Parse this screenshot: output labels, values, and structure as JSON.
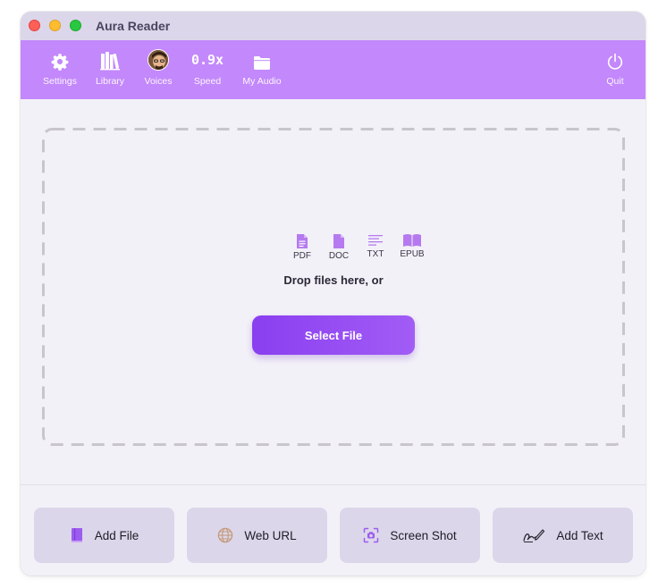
{
  "window": {
    "title": "Aura Reader"
  },
  "toolbar": {
    "settings": {
      "label": "Settings",
      "icon": "gear-icon"
    },
    "library": {
      "label": "Library",
      "icon": "books-icon"
    },
    "voices": {
      "label": "Voices",
      "icon": "avatar"
    },
    "speed": {
      "label": "Speed",
      "value": "0.9x"
    },
    "my_audio": {
      "label": "My Audio",
      "icon": "folder-icon"
    },
    "quit": {
      "label": "Quit",
      "icon": "power-icon"
    }
  },
  "dropzone": {
    "formats": [
      {
        "label": "PDF",
        "icon": "document-icon"
      },
      {
        "label": "DOC",
        "icon": "document-icon"
      },
      {
        "label": "TXT",
        "icon": "text-lines-icon"
      },
      {
        "label": "EPUB",
        "icon": "open-book-icon"
      }
    ],
    "prompt": "Drop files here, or",
    "select_label": "Select File"
  },
  "actions": [
    {
      "label": "Add File",
      "icon": "book-icon"
    },
    {
      "label": "Web URL",
      "icon": "globe-icon"
    },
    {
      "label": "Screen Shot",
      "icon": "camera-frame-icon"
    },
    {
      "label": "Add Text",
      "icon": "signature-pen-icon"
    }
  ],
  "colors": {
    "toolbar_bg": "#c388fb",
    "accent": "#8a3ff0",
    "icon_purple": "#b57af0",
    "card_bg": "#dcd6ea"
  }
}
